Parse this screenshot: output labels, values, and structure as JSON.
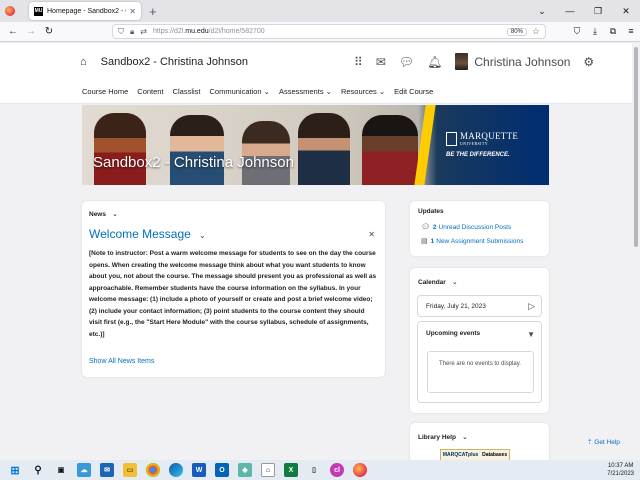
{
  "browser": {
    "tab_title": "Homepage - Sandbox2 - Chris",
    "tab_favicon_text": "MU",
    "url_prefix": "https://d2l.",
    "url_domain": "mu.edu",
    "url_path": "/d2l/home/582700",
    "zoom": "80%"
  },
  "header": {
    "course_title": "Sandbox2 - Christina Johnson",
    "user_name": "Christina Johnson"
  },
  "nav": {
    "items": [
      "Course Home",
      "Content",
      "Classlist",
      "Communication ⌄",
      "Assessments ⌄",
      "Resources ⌄",
      "Edit Course"
    ]
  },
  "banner": {
    "title": "Sandbox2 - Christina Johnson",
    "logo_name": "MARQUETTE",
    "logo_sub": "UNIVERSITY",
    "tagline": "BE THE DIFFERENCE."
  },
  "news": {
    "widget_title": "News",
    "item_title": "Welcome Message",
    "body": "[Note to instructor: Post a warm welcome message for students to see on the day the course opens. When creating the welcome message think about what you want students to know about you, not about the course. The message should present you as professional as well as approachable. Remember students have the course information on the syllabus. In your welcome message: (1) include a photo of yourself or create and post a brief welcome video; (2) include your contact information; (3) point students to the course content they should visit first (e.g., the \"Start Here Module\" with the course syllabus, schedule of assignments, etc.)]",
    "show_all": "Show All News Items"
  },
  "updates": {
    "title": "Updates",
    "discussion_count": "2",
    "discussion_label": "Unread Discussion Posts",
    "assignment_count": "1",
    "assignment_label": "New Assignment Submissions"
  },
  "calendar": {
    "title": "Calendar",
    "date": "Friday, July 21, 2023",
    "upcoming_label": "Upcoming events",
    "no_events": "There are no events to display."
  },
  "library": {
    "title": "Library Help",
    "marquette_plus": "MARQCATplus",
    "databases": "Databases"
  },
  "get_help": "Get Help",
  "taskbar": {
    "time": "10:37 AM",
    "date": "7/21/2023"
  },
  "colors": {
    "link": "#006fbf",
    "marquette_blue": "#002d72",
    "marquette_gold": "#ffcc00"
  }
}
